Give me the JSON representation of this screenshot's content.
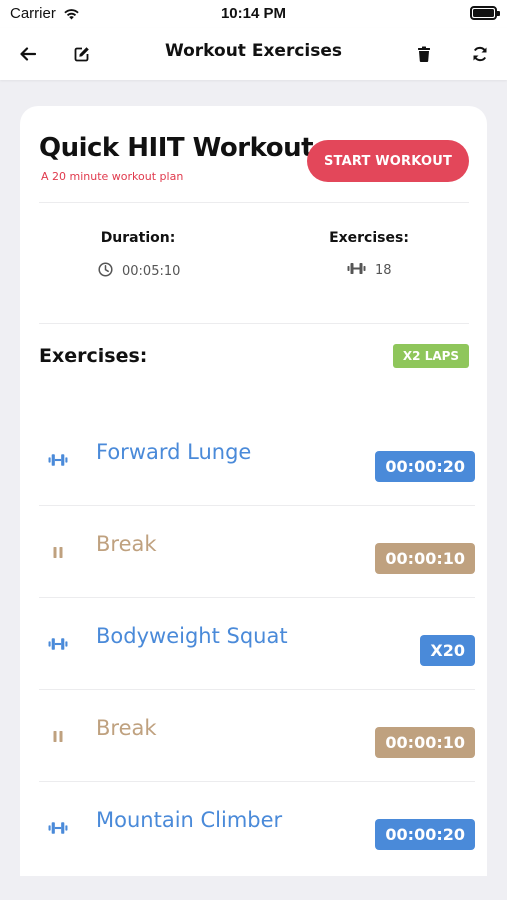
{
  "status_bar": {
    "carrier": "Carrier",
    "time": "10:14 PM"
  },
  "nav": {
    "title": "Workout Exercises",
    "icons": [
      "back-arrow-icon",
      "edit-icon",
      "trash-icon",
      "refresh-icon"
    ]
  },
  "workout": {
    "title": "Quick HIIT Workout",
    "subtitle": "A 20 minute workout plan",
    "start_label": "START WORKOUT"
  },
  "stats": {
    "duration_label": "Duration:",
    "duration_value": "00:05:10",
    "exercises_label": "Exercises:",
    "exercises_value": "18"
  },
  "section": {
    "title": "Exercises:",
    "laps": "X2 LAPS"
  },
  "exercises": [
    {
      "name": "Forward Lunge",
      "badge": "00:00:20",
      "kind": "exercise",
      "icon": "dumbbell-icon"
    },
    {
      "name": "Break",
      "badge": "00:00:10",
      "kind": "break",
      "icon": "pause-icon"
    },
    {
      "name": "Bodyweight Squat",
      "badge": "X20",
      "kind": "exercise",
      "icon": "dumbbell-icon"
    },
    {
      "name": "Break",
      "badge": "00:00:10",
      "kind": "break",
      "icon": "pause-icon"
    },
    {
      "name": "Mountain Climber",
      "badge": "00:00:20",
      "kind": "exercise",
      "icon": "dumbbell-icon"
    }
  ],
  "colors": {
    "accent_red": "#e3475a",
    "exercise_blue": "#4a8ad9",
    "break_tan": "#bfa17f",
    "laps_green": "#8fc65b",
    "background": "#efeff3"
  }
}
